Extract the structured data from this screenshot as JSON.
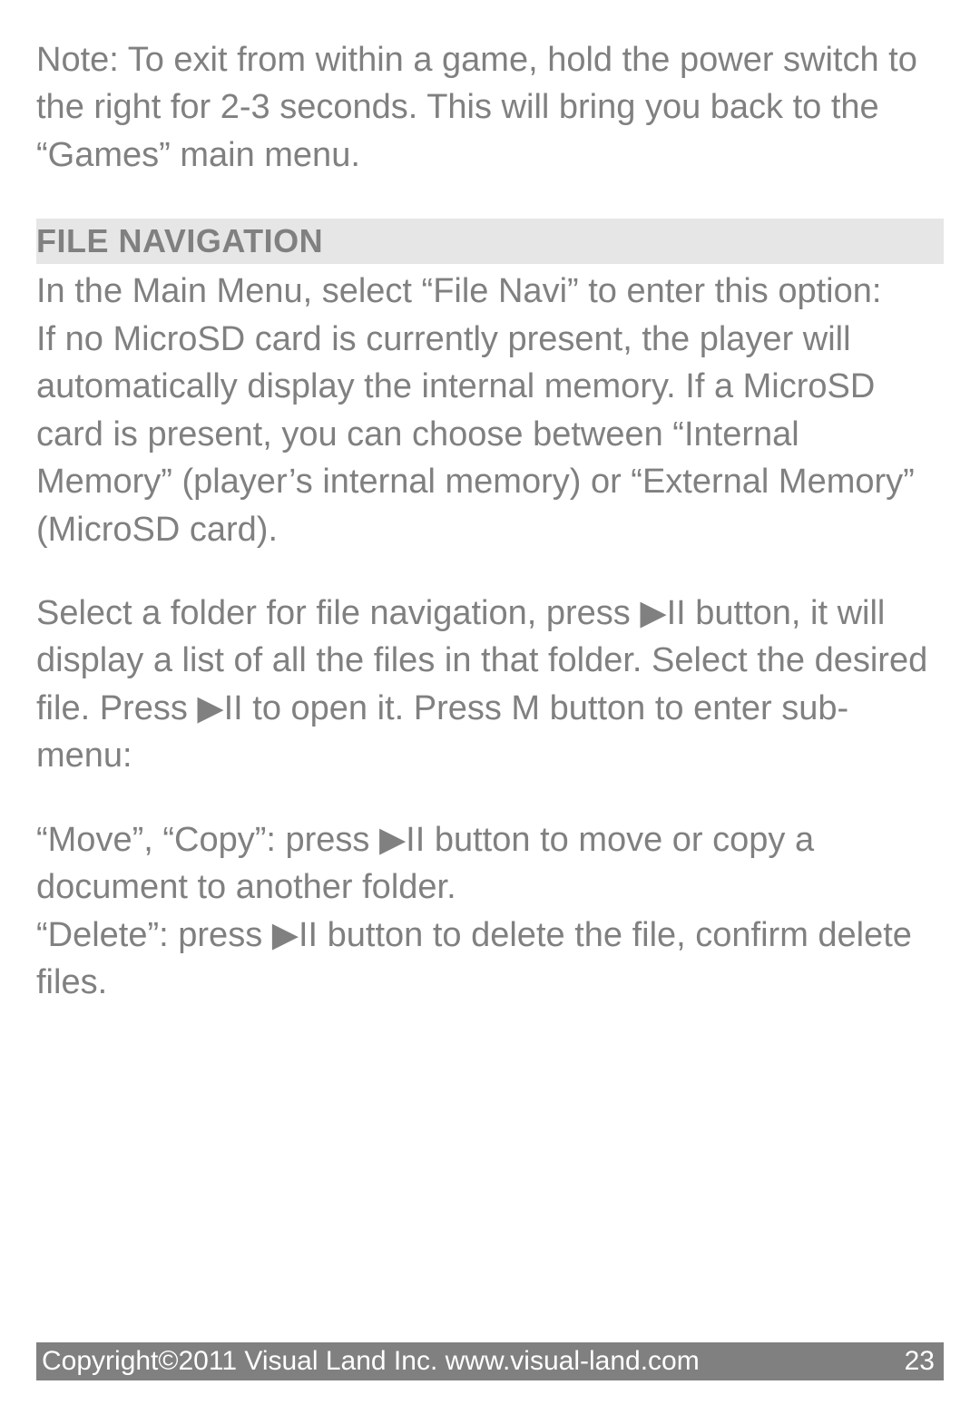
{
  "note": "Note: To exit from within a game, hold the power switch to the right for 2-3 seconds.  This will bring you back to the “Games” main menu.",
  "section": {
    "heading": "FILE NAVIGATION",
    "para1": "In the Main Menu, select “File Navi” to enter this option:\nIf no MicroSD card is currently present, the player will automatically display the internal memory.  If a MicroSD card is present, you can choose between “Internal Memory” (player’s internal memory) or “External Memory” (MicroSD card).",
    "para2": "Select a folder for file navigation, press ▶II button, it will display a list of all the files in that folder. Select the desired file. Press ▶II to open it.  Press M button to enter sub-menu:",
    "para3": "“Move”, “Copy”: press ▶II button to move or copy a document to another folder.\n“Delete”: press ▶II button to delete the file, confirm delete files."
  },
  "footer": {
    "copyright": "Copyright©2011 Visual Land Inc. www.visual-land.com",
    "page_number": "23"
  }
}
